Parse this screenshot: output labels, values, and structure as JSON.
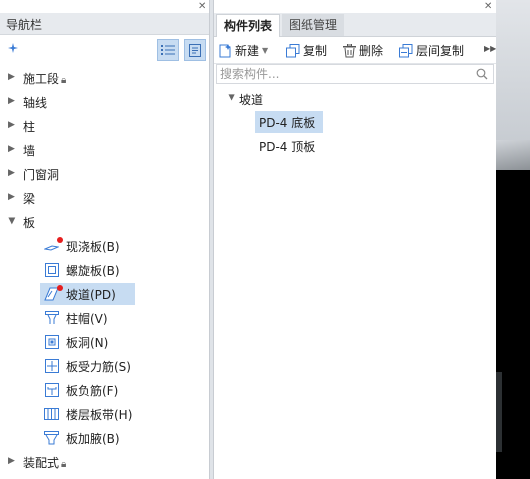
{
  "nav_panel": {
    "title": "导航栏",
    "categories": [
      {
        "label": "施工段",
        "locked": true
      },
      {
        "label": "轴线"
      },
      {
        "label": "柱"
      },
      {
        "label": "墙"
      },
      {
        "label": "门窗洞"
      },
      {
        "label": "梁"
      },
      {
        "label": "板",
        "expanded": true
      }
    ],
    "board_items": [
      {
        "label": "现浇板(B)",
        "icon": "cast-slab-icon",
        "marked": true
      },
      {
        "label": "螺旋板(B)",
        "icon": "spiral-slab-icon"
      },
      {
        "label": "坡道(PD)",
        "icon": "ramp-icon",
        "marked": true,
        "selected": true
      },
      {
        "label": "柱帽(V)",
        "icon": "column-cap-icon"
      },
      {
        "label": "板洞(N)",
        "icon": "slab-opening-icon"
      },
      {
        "label": "板受力筋(S)",
        "icon": "slab-rebar-icon"
      },
      {
        "label": "板负筋(F)",
        "icon": "negative-rebar-icon"
      },
      {
        "label": "楼层板带(H)",
        "icon": "floor-strip-icon"
      },
      {
        "label": "板加腋(B)",
        "icon": "haunch-icon"
      }
    ],
    "last_category": {
      "label": "装配式",
      "locked": true
    }
  },
  "component_panel": {
    "tabs": [
      "构件列表",
      "图纸管理"
    ],
    "active_tab": 0,
    "toolbar": {
      "new_label": "新建",
      "copy_label": "复制",
      "delete_label": "删除",
      "floor_copy_label": "层间复制"
    },
    "search_placeholder": "搜索构件...",
    "tree": {
      "group": "坡道",
      "items": [
        {
          "label": "PD-4 底板",
          "selected": true
        },
        {
          "label": "PD-4 顶板"
        }
      ]
    }
  },
  "colors": {
    "selection": "#c7dcf2",
    "marker": "#e61e1e",
    "accent": "#3a7bd5"
  }
}
